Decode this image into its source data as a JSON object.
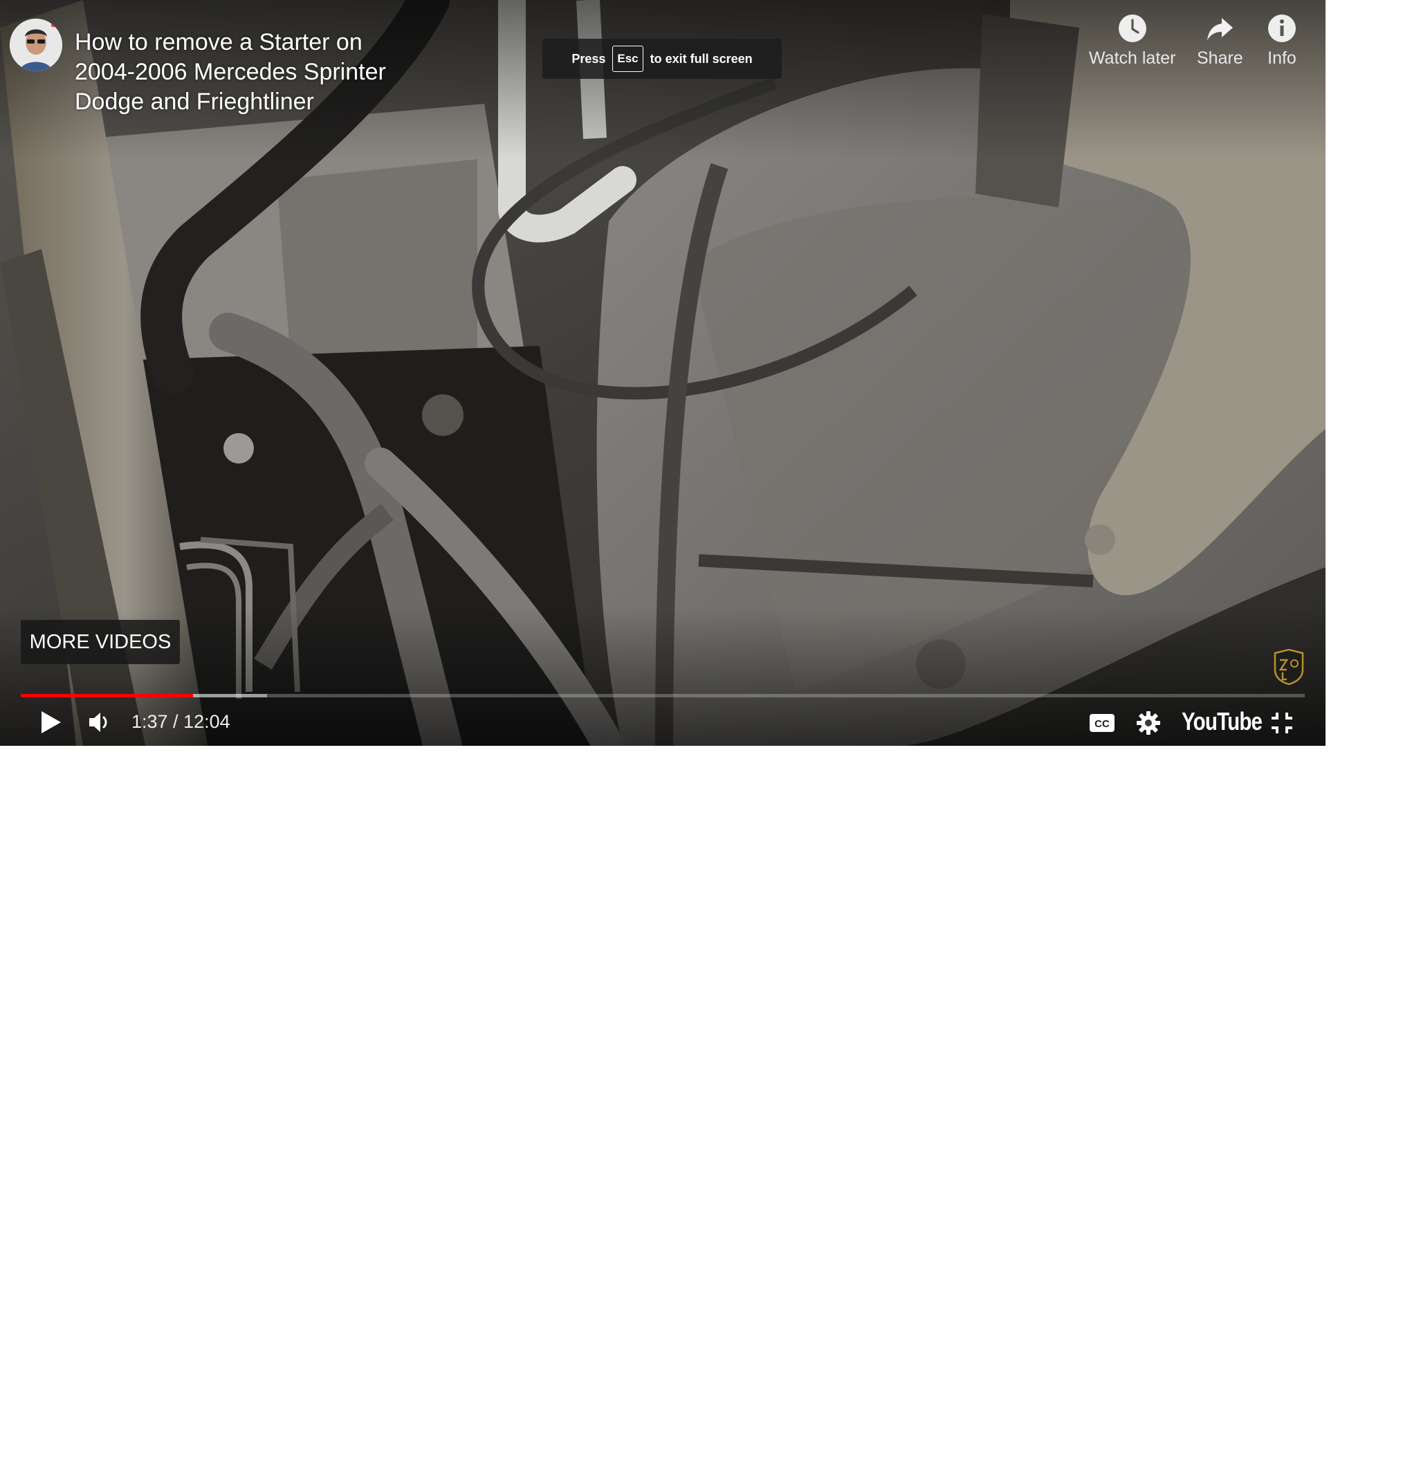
{
  "video": {
    "title": "How to remove a Starter on 2004-2006 Mercedes Sprinter Dodge and Frieghtliner"
  },
  "toast": {
    "press": "Press",
    "key": "Esc",
    "suffix": "to exit full screen"
  },
  "top_actions": [
    {
      "label": "Watch later",
      "icon": "clock-icon"
    },
    {
      "label": "Share",
      "icon": "share-arrow-icon"
    },
    {
      "label": "Info",
      "icon": "info-icon"
    }
  ],
  "more_videos": {
    "label": "MORE VIDEOS"
  },
  "controls": {
    "time": "1:37 / 12:04",
    "progress_played_fraction": 0.134,
    "progress_loaded_fraction": 0.192,
    "logo_text": "YouTube"
  },
  "colors": {
    "progress_played": "#ff0000",
    "controls_text": "#ffffff"
  }
}
